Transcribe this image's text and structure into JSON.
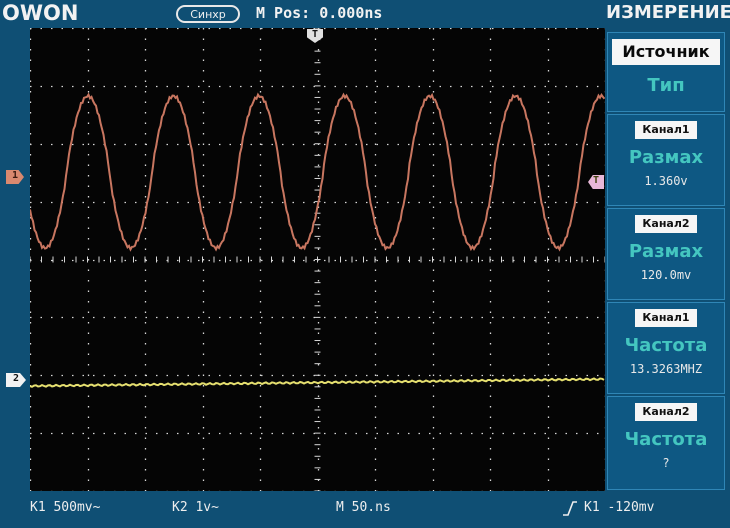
{
  "header": {
    "brand": "OWON",
    "sync_label": "Синхр",
    "mpos": "M Pos: 0.000ns",
    "menu_title": "ИЗМЕРЕНИЕ"
  },
  "markers": {
    "trigger_top": "T",
    "ch1": "1",
    "ch2": "2",
    "trigger_level": "T"
  },
  "side_menu": {
    "source_label": "Источник",
    "type_label": "Тип",
    "items": [
      {
        "channel": "Канал1",
        "measure": "Размах",
        "value": "1.360v"
      },
      {
        "channel": "Канал2",
        "measure": "Размах",
        "value": "120.0mv"
      },
      {
        "channel": "Канал1",
        "measure": "Частота",
        "value": "13.3263MHZ"
      },
      {
        "channel": "Канал2",
        "measure": "Частота",
        "value": "?"
      }
    ]
  },
  "status_bar": {
    "ch1_scale": "K1 500mv~",
    "ch2_scale": "K2 1v~",
    "timebase": "M 50.ns",
    "trigger": "K1 -120mv"
  },
  "colors": {
    "ch1_trace": "#c87660",
    "ch2_trace": "#e6e070",
    "accent": "#44c6c0"
  }
}
